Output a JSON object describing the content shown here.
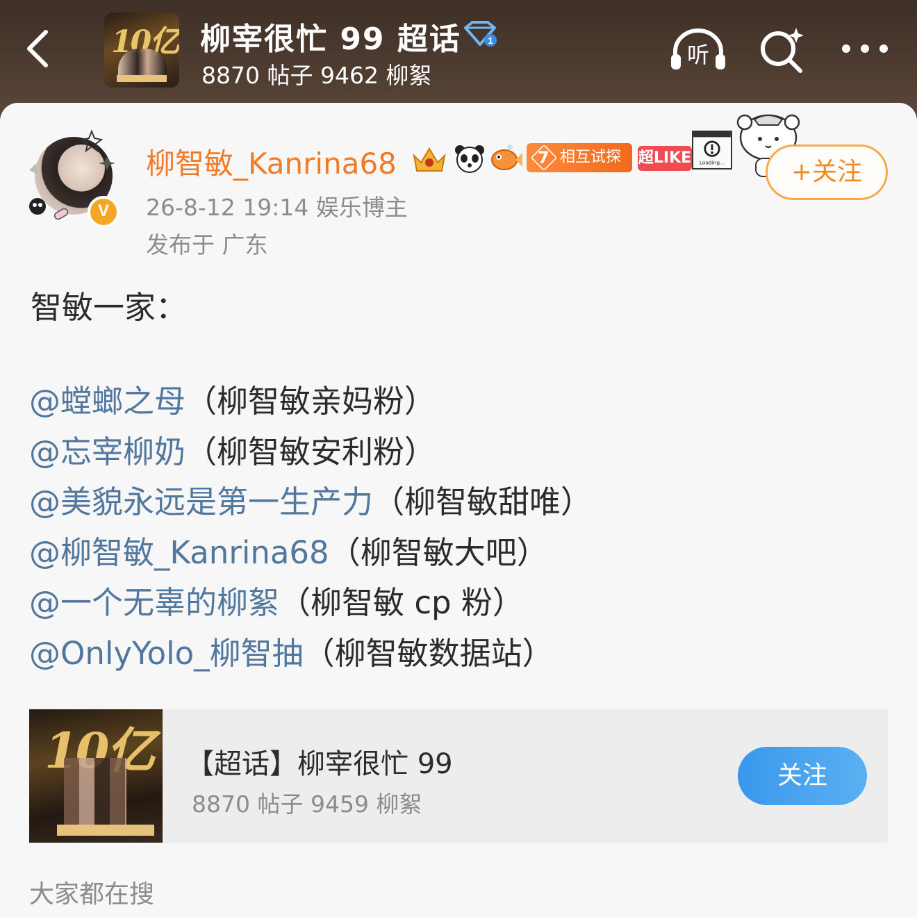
{
  "header": {
    "title": "柳宰很忙 99 超话",
    "stats": "8870 帖子 9462 柳絮",
    "cover_text": "10亿",
    "listen_label": "听"
  },
  "post": {
    "username": "柳智敏_Kanrina68",
    "tag_level": "7",
    "tag_mutual": "相互试探",
    "tag_superlike": "超LIKE",
    "loading_text": "Loading...",
    "follow_label": "+关注",
    "verified_mark": "V",
    "time_role": "26-8-12 19:14  娱乐博主",
    "location": "发布于 广东",
    "heading": "智敏一家：",
    "mentions": [
      {
        "handle": "@螳螂之母",
        "desc": "（柳智敏亲妈粉）"
      },
      {
        "handle": "@忘宰柳奶",
        "desc": "（柳智敏安利粉）"
      },
      {
        "handle": "@美貌永远是第一生产力",
        "desc": "（柳智敏甜唯）"
      },
      {
        "handle": "@柳智敏_Kanrina68",
        "desc": "（柳智敏大吧）"
      },
      {
        "handle": "@一个无辜的柳絮",
        "desc": "（柳智敏 cp 粉）"
      },
      {
        "handle": "@OnlyYolo_柳智抽",
        "desc": "（柳智敏数据站）"
      }
    ]
  },
  "topic_card": {
    "name": "【超话】柳宰很忙 99",
    "stats": "8870 帖子 9459 柳絮",
    "follow_label": "关注",
    "cover_text": "10亿"
  },
  "footer": {
    "label": "大家都在搜"
  },
  "colors": {
    "header_bg": "#4a3a30",
    "username": "#f07c28",
    "mention": "#52779e",
    "follow_outline": "#f7a848",
    "topic_follow": "#3a97ec"
  },
  "icons": [
    "back-arrow-icon",
    "diamond-badge-icon",
    "listen-headphone-icon",
    "search-sparkle-icon",
    "more-dots-icon",
    "crown-icon",
    "panda-icon",
    "fish-icon",
    "alert-window-icon",
    "bear-sticker-icon"
  ]
}
